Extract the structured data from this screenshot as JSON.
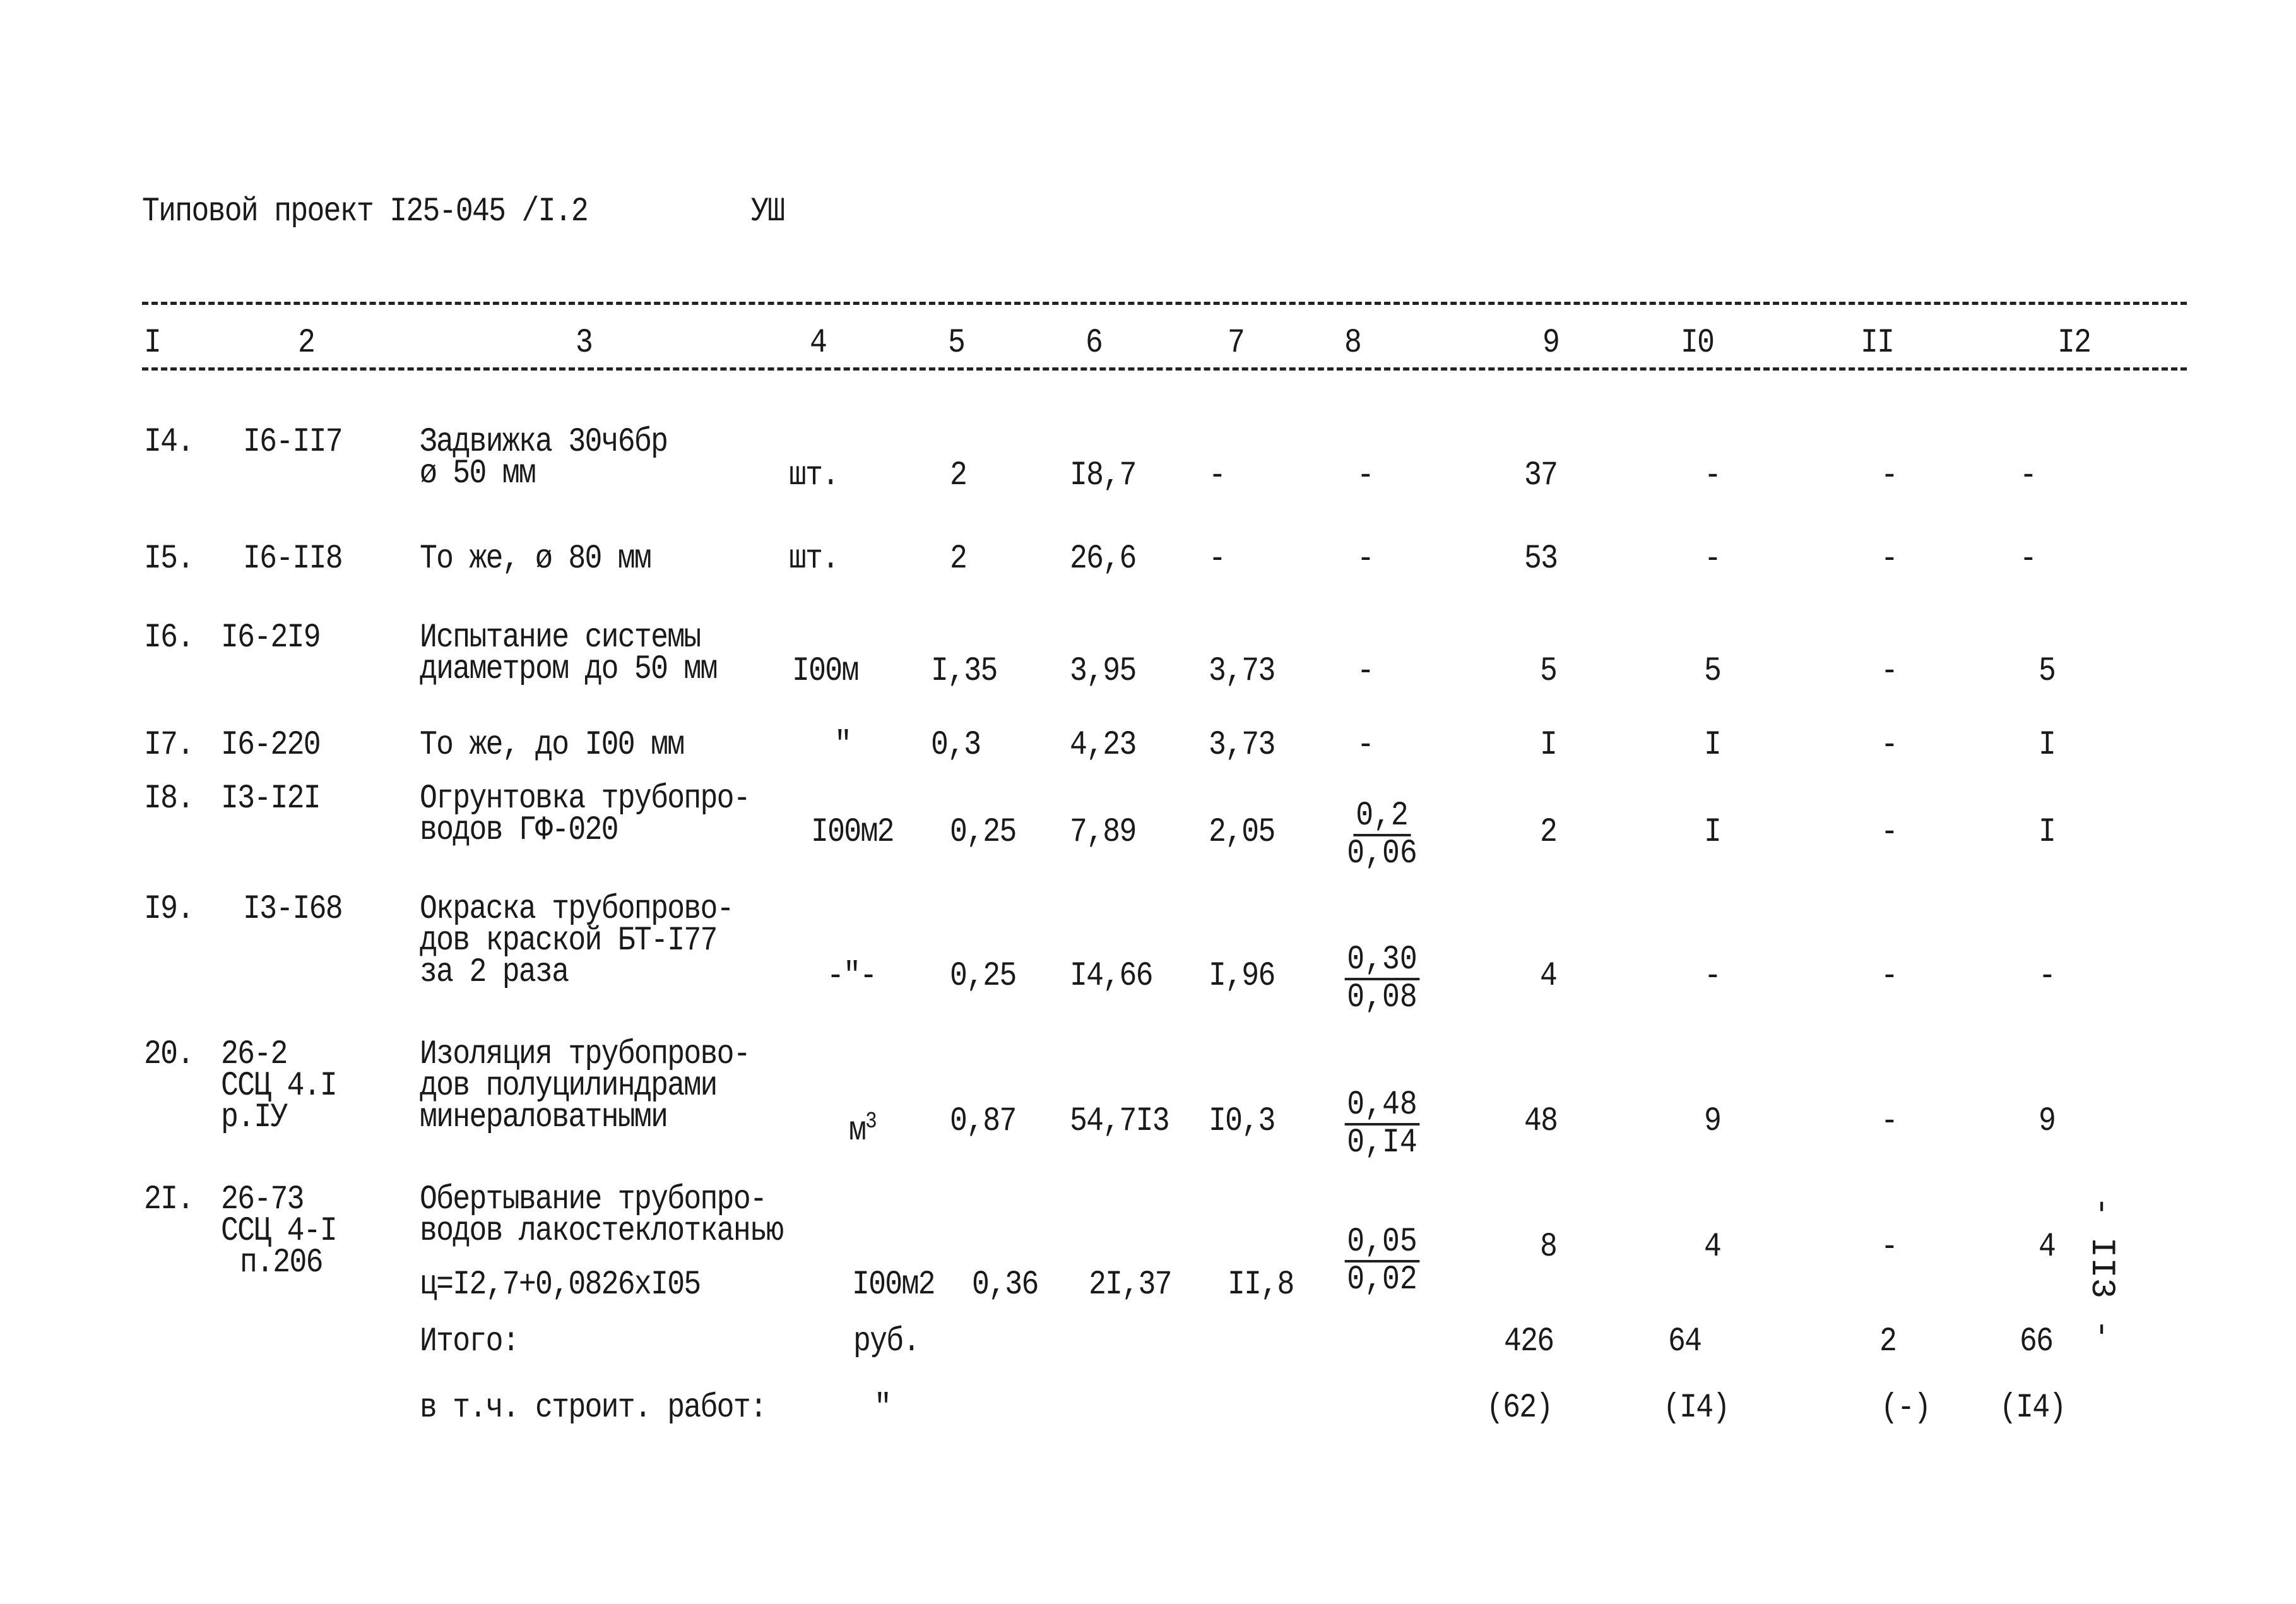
{
  "header": {
    "title": "Типовой проект I25-045 /I.2",
    "section": "УШ"
  },
  "columns": [
    "I",
    "2",
    "3",
    "4",
    "5",
    "6",
    "7",
    "8",
    "9",
    "I0",
    "II",
    "I2"
  ],
  "rows": [
    {
      "n": "I4.",
      "code": [
        "I6-II7"
      ],
      "desc": [
        "Задвижка 30ч6бр",
        "ø 50 мм"
      ],
      "unit": "шт.",
      "qty": "2",
      "c6": "I8,7",
      "c7": "-",
      "c8": "-",
      "c8b": "",
      "c9": "37",
      "c10": "-",
      "c11": "-",
      "c12": "-"
    },
    {
      "n": "I5.",
      "code": [
        "I6-II8"
      ],
      "desc": [
        "То же, ø 80 мм"
      ],
      "unit": "шт.",
      "qty": "2",
      "c6": "26,6",
      "c7": "-",
      "c8": "-",
      "c8b": "",
      "c9": "53",
      "c10": "-",
      "c11": "-",
      "c12": "-"
    },
    {
      "n": "I6.",
      "code": [
        "I6-2I9"
      ],
      "desc": [
        "Испытание системы",
        "диаметром до 50 мм"
      ],
      "unit": "I00м",
      "qty": "I,35",
      "c6": "3,95",
      "c7": "3,73",
      "c8": "-",
      "c8b": "",
      "c9": "5",
      "c10": "5",
      "c11": "-",
      "c12": "5"
    },
    {
      "n": "I7.",
      "code": [
        "I6-220"
      ],
      "desc": [
        "То же, до I00 мм"
      ],
      "unit": "\"",
      "qty": "0,3",
      "c6": "4,23",
      "c7": "3,73",
      "c8": "-",
      "c8b": "",
      "c9": "I",
      "c10": "I",
      "c11": "-",
      "c12": "I"
    },
    {
      "n": "I8.",
      "code": [
        "I3-I2I"
      ],
      "desc": [
        "Огрунтовка трубопро-",
        "водов ГФ-020"
      ],
      "unit": "I00м2",
      "qty": "0,25",
      "c6": "7,89",
      "c7": "2,05",
      "c8": "0,2",
      "c8b": "0,06",
      "c9": "2",
      "c10": "I",
      "c11": "-",
      "c12": "I"
    },
    {
      "n": "I9.",
      "code": [
        "I3-I68"
      ],
      "desc": [
        "Окраска трубопрово-",
        "дов краской БТ-I77",
        "за 2 раза"
      ],
      "unit": "-\"-",
      "qty": "0,25",
      "c6": "I4,66",
      "c7": "I,96",
      "c8": "0,30",
      "c8b": "0,08",
      "c9": "4",
      "c10": "-",
      "c11": "-",
      "c12": "-"
    },
    {
      "n": "20.",
      "code": [
        "26-2",
        "ССЦ 4.I",
        "р.IУ"
      ],
      "desc": [
        "Изоляция трубопрово-",
        "дов полуцилиндрами",
        "минераловатными"
      ],
      "unit": "м",
      "unit_sup": "3",
      "qty": "0,87",
      "c6": "54,7I3",
      "c7": "I0,3",
      "c8": "0,48",
      "c8b": "0,I4",
      "c9": "48",
      "c10": "9",
      "c11": "-",
      "c12": "9"
    },
    {
      "n": "2I.",
      "code": [
        "26-73",
        "ССЦ 4-I",
        "п.206"
      ],
      "desc": [
        "Обертывание трубопро-",
        "водов лакостеклотканью",
        "ц=I2,7+0,0826хI05"
      ],
      "unit": "I00м2",
      "qty": "0,36",
      "c6": "2I,37",
      "c7": "II,8",
      "c8": "0,05",
      "c8b": "0,02",
      "c9": "8",
      "c10": "4",
      "c11": "-",
      "c12": "4"
    }
  ],
  "totals": {
    "label": "Итого:",
    "unit": "руб.",
    "c9": "426",
    "c10": "64",
    "c11": "2",
    "c12": "66"
  },
  "subtotal": {
    "label": "в т.ч. строит. работ:",
    "unit": "\"",
    "c9": "(62)",
    "c10": "(I4)",
    "c11": "(-)",
    "c12": "(I4)"
  },
  "page_number": "- II3 -"
}
